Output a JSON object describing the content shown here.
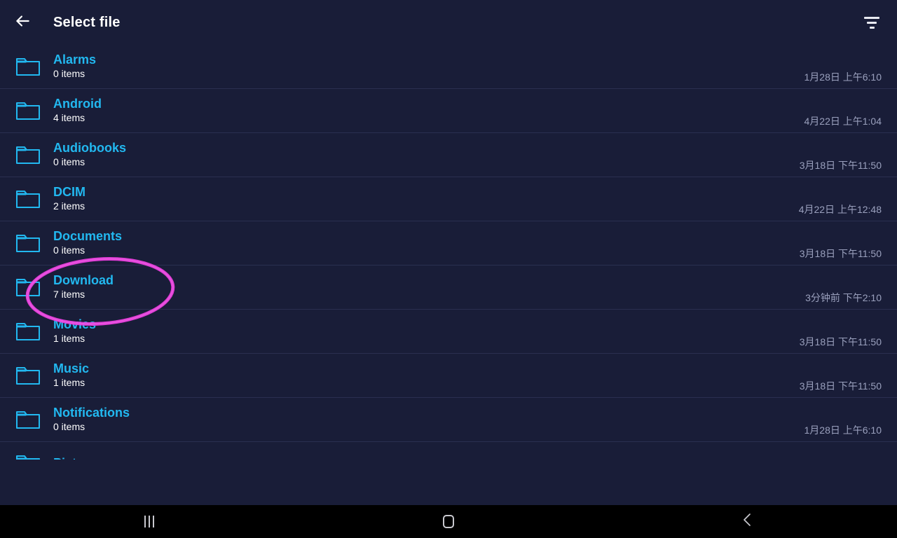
{
  "appbar": {
    "back_icon": "arrow-left-icon",
    "title": "Select file",
    "filter_icon": "filter-icon"
  },
  "colors": {
    "background": "#191d38",
    "row_divider": "#2a2f50",
    "folder_name": "#22b8f0",
    "item_count": "#ffffff",
    "timestamp": "#9aa0bd",
    "title": "#ffffff",
    "annotation": "#e93ddd",
    "navbar": "#000000"
  },
  "file_list": {
    "items": [
      {
        "icon": "folder-icon",
        "name": "Alarms",
        "count": "0 items",
        "date": "1月28日 上午6:10"
      },
      {
        "icon": "folder-icon",
        "name": "Android",
        "count": "4 items",
        "date": "4月22日 上午1:04"
      },
      {
        "icon": "folder-icon",
        "name": "Audiobooks",
        "count": "0 items",
        "date": "3月18日 下午11:50"
      },
      {
        "icon": "folder-icon",
        "name": "DCIM",
        "count": "2 items",
        "date": "4月22日 上午12:48"
      },
      {
        "icon": "folder-icon",
        "name": "Documents",
        "count": "0 items",
        "date": "3月18日 下午11:50"
      },
      {
        "icon": "folder-icon",
        "name": "Download",
        "count": "7 items",
        "date": "3分钟前 下午2:10"
      },
      {
        "icon": "folder-icon",
        "name": "Movies",
        "count": "1 items",
        "date": "3月18日 下午11:50"
      },
      {
        "icon": "folder-icon",
        "name": "Music",
        "count": "1 items",
        "date": "3月18日 下午11:50"
      },
      {
        "icon": "folder-icon",
        "name": "Notifications",
        "count": "0 items",
        "date": "1月28日 上午6:10"
      },
      {
        "icon": "folder-icon",
        "name": "Pictures",
        "count": "",
        "date": ""
      }
    ]
  },
  "annotation": {
    "shape": "ellipse-highlight",
    "target": "Download"
  },
  "navbar": {
    "buttons": [
      {
        "icon": "recent-apps-icon",
        "label": "Recents"
      },
      {
        "icon": "home-icon",
        "label": "Home"
      },
      {
        "icon": "back-chevron-icon",
        "label": "Back"
      }
    ]
  }
}
